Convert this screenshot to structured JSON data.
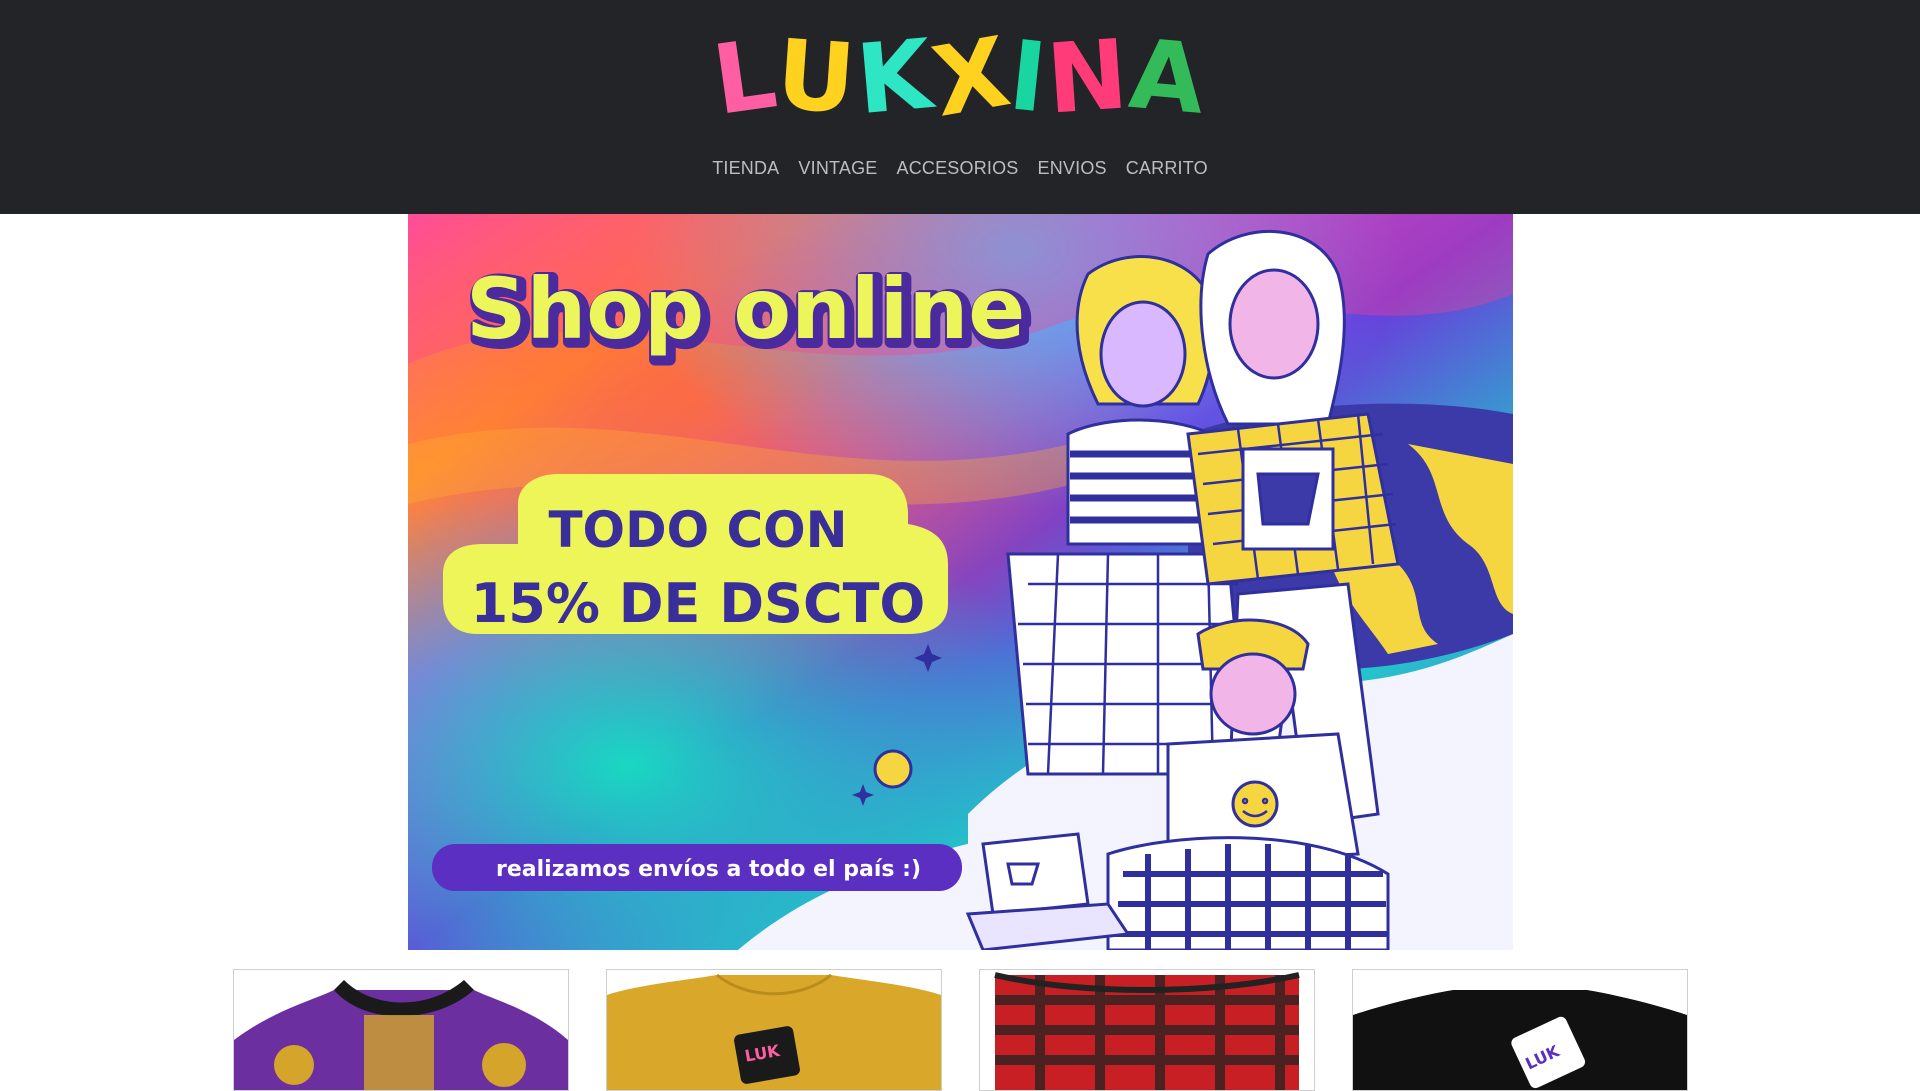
{
  "brand": {
    "word1": "LUK",
    "word2": "XINA",
    "letter_colors": [
      "#ff5fa2",
      "#ffd21f",
      "#2ee6c4",
      "#ffd21f",
      "#19d6a0",
      "#ff3b7a",
      "#33bb5a"
    ]
  },
  "nav": {
    "items": [
      "TIENDA",
      "VINTAGE",
      "ACCESORIOS",
      "ENVIOS",
      "CARRITO"
    ]
  },
  "banner": {
    "headline": "Shop online",
    "promo_line1": "TODO CON",
    "promo_line2": "15% DE DSCTO",
    "shipping": "realizamos envíos a todo el país :)",
    "colors": {
      "headline_fill": "#ecf55a",
      "headline_outline": "#4a2a9c",
      "promo_bg": "#eef559",
      "promo_text": "#3a2f9a",
      "pill_bg": "#5a2fc2",
      "pill_text": "#ffffff",
      "ink": "#3b3aa8"
    }
  },
  "products": [
    {
      "name": "vintage-print-jacket",
      "palette": [
        "#6b2fa0",
        "#d4a52a",
        "#1a1a1a"
      ]
    },
    {
      "name": "mustard-luk-xina-tee",
      "palette": [
        "#d9a82a",
        "#1a1a1a"
      ]
    },
    {
      "name": "red-plaid-pants",
      "palette": [
        "#c81f24",
        "#222222"
      ]
    },
    {
      "name": "black-luk-xina-tee",
      "palette": [
        "#111111",
        "#ffffff"
      ]
    }
  ]
}
